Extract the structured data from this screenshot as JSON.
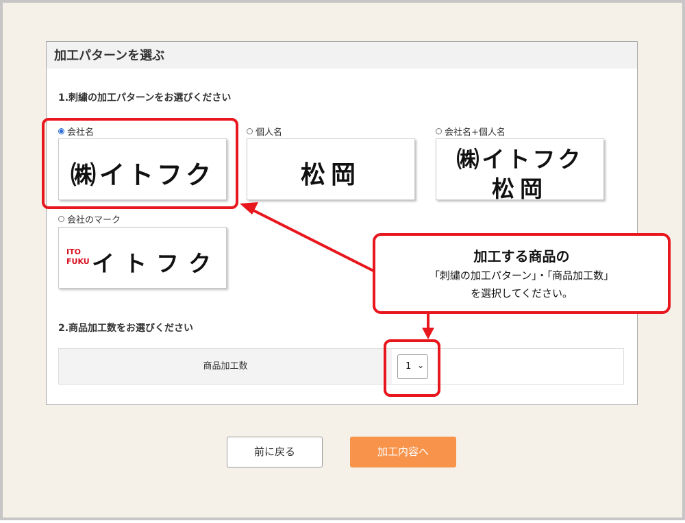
{
  "panel": {
    "title": "加工パターンを選ぶ"
  },
  "section1": {
    "heading": "1.刺繍の加工パターンをお選びください"
  },
  "options": [
    {
      "label": "会社名",
      "selected": true,
      "preview": "㈱イトフク"
    },
    {
      "label": "個人名",
      "selected": false,
      "preview": "松岡"
    },
    {
      "label": "会社名+個人名",
      "selected": false,
      "preview_line1": "㈱イトフク",
      "preview_line2": "松岡"
    },
    {
      "label": "会社のマーク",
      "selected": false,
      "preview": "イトフク",
      "logo_line1": "ITO",
      "logo_line2": "FUKU"
    }
  ],
  "callout": {
    "title": "加工する商品の",
    "line2": "「刺繍の加工パターン」・「商品加工数」",
    "line3": "を選択してください。"
  },
  "section2": {
    "heading": "2.商品加工数をお選びください"
  },
  "quantity": {
    "label": "商品加工数",
    "value": "1"
  },
  "buttons": {
    "back": "前に戻る",
    "next": "加工内容へ"
  },
  "colors": {
    "accent": "#f7934b",
    "annotation": "#e8161d",
    "radio_selected": "#2f6fd6"
  }
}
